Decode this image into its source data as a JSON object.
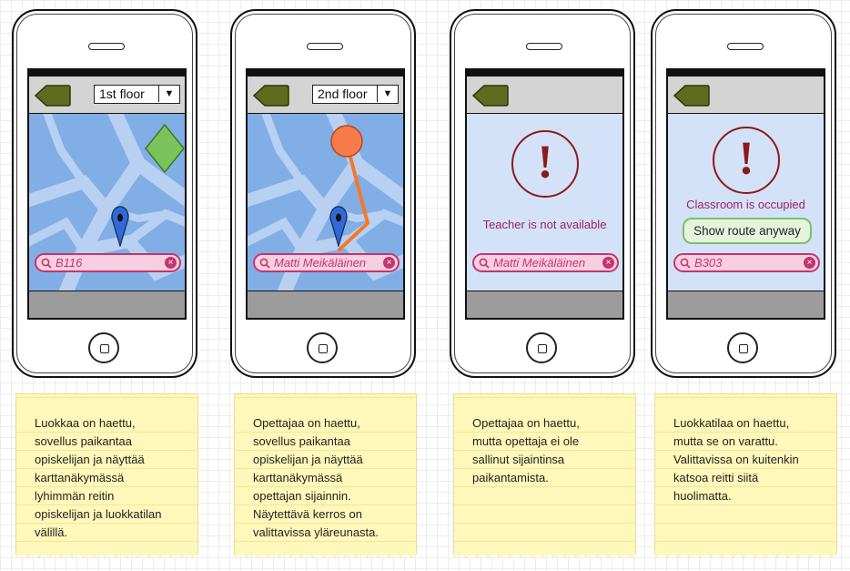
{
  "phones": [
    {
      "floor_select": "1st floor",
      "select_arrow": "▼",
      "search_value": "B116",
      "note": "Luokkaa on haettu,\nsovellus paikantaa\nopiskelijan ja näyttää\nkarttanäkymässä\nlyhimmän reitin\nopiskelijan ja luokkatilan\nvälillä."
    },
    {
      "floor_select": "2nd floor",
      "select_arrow": "▼",
      "search_value": "Matti Meikäläinen",
      "note": "Opettajaa on haettu,\nsovellus paikantaa\nopiskelijan ja näyttää\nkarttanäkymässä\nopettajan sijainnin.\nNäytettävä kerros on\nvalittavissa yläreunasta."
    },
    {
      "message": "Teacher is not available",
      "search_value": "Matti Meikäläinen",
      "note": "Opettajaa on haettu,\nmutta opettaja ei ole\nsallinut sijaintinsa\npaikantamista."
    },
    {
      "message": "Classroom is occupied",
      "button_label": "Show route anyway",
      "search_value": "B303",
      "note": "Luokkatilaa on haettu,\nmutta se on varattu.\nValittavissa on kuitenkin\nkatsoa reitti siitä\nhuolimatta."
    }
  ],
  "warning_symbol": "!",
  "clear_symbol": "×",
  "colors": {
    "map_blue": "#82aee6",
    "street": "#b8d0f2",
    "back_button": "#5f6b1e",
    "search_pink": "#f8cfe0",
    "search_border": "#c0376f",
    "warning": "#8b1a1a",
    "route_orange": "#f5772a",
    "destination_green": "#7bc45c",
    "note_yellow": "#fff8ba"
  },
  "icons": [
    "back-arrow-icon",
    "search-icon",
    "clear-icon",
    "location-pin-icon",
    "warning-icon",
    "home-button"
  ]
}
